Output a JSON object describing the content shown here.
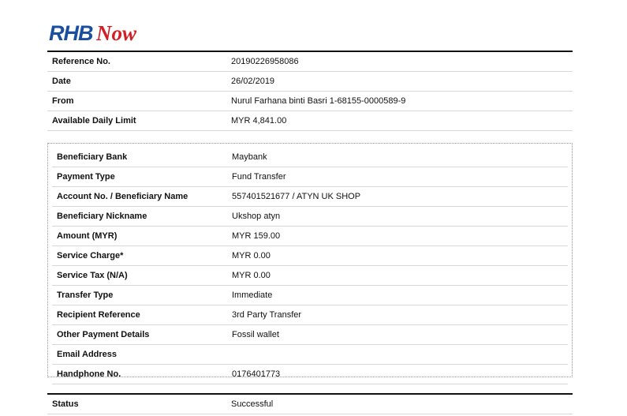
{
  "logo": {
    "text": "RHBNow",
    "brand_blue": "#1a4fa0",
    "brand_red": "#d21f26"
  },
  "summary": [
    {
      "label": "Reference No.",
      "value": "20190226958086"
    },
    {
      "label": "Date",
      "value": "26/02/2019"
    },
    {
      "label": "From",
      "value": "Nurul Farhana binti Basri 1-68155-0000589-9"
    },
    {
      "label": "Available Daily Limit",
      "value": "MYR 4,841.00"
    }
  ],
  "details": [
    {
      "label": "Beneficiary Bank",
      "value": "Maybank"
    },
    {
      "label": "Payment Type",
      "value": "Fund Transfer"
    },
    {
      "label": "Account No. / Beneficiary Name",
      "value": "557401521677 / ATYN UK SHOP"
    },
    {
      "label": "Beneficiary Nickname",
      "value": "Ukshop atyn"
    },
    {
      "label": "Amount (MYR)",
      "value": "MYR 159.00"
    },
    {
      "label": "Service Charge*",
      "value": "MYR 0.00"
    },
    {
      "label": "Service Tax (N/A)",
      "value": "MYR 0.00"
    },
    {
      "label": "Transfer Type",
      "value": "Immediate"
    },
    {
      "label": "Recipient Reference",
      "value": "3rd Party Transfer"
    },
    {
      "label": "Other Payment Details",
      "value": "Fossil wallet"
    },
    {
      "label": "Email Address",
      "value": ""
    },
    {
      "label": "Handphone No.",
      "value": "0176401773"
    }
  ],
  "status": {
    "label": "Status",
    "value": "Successful"
  }
}
